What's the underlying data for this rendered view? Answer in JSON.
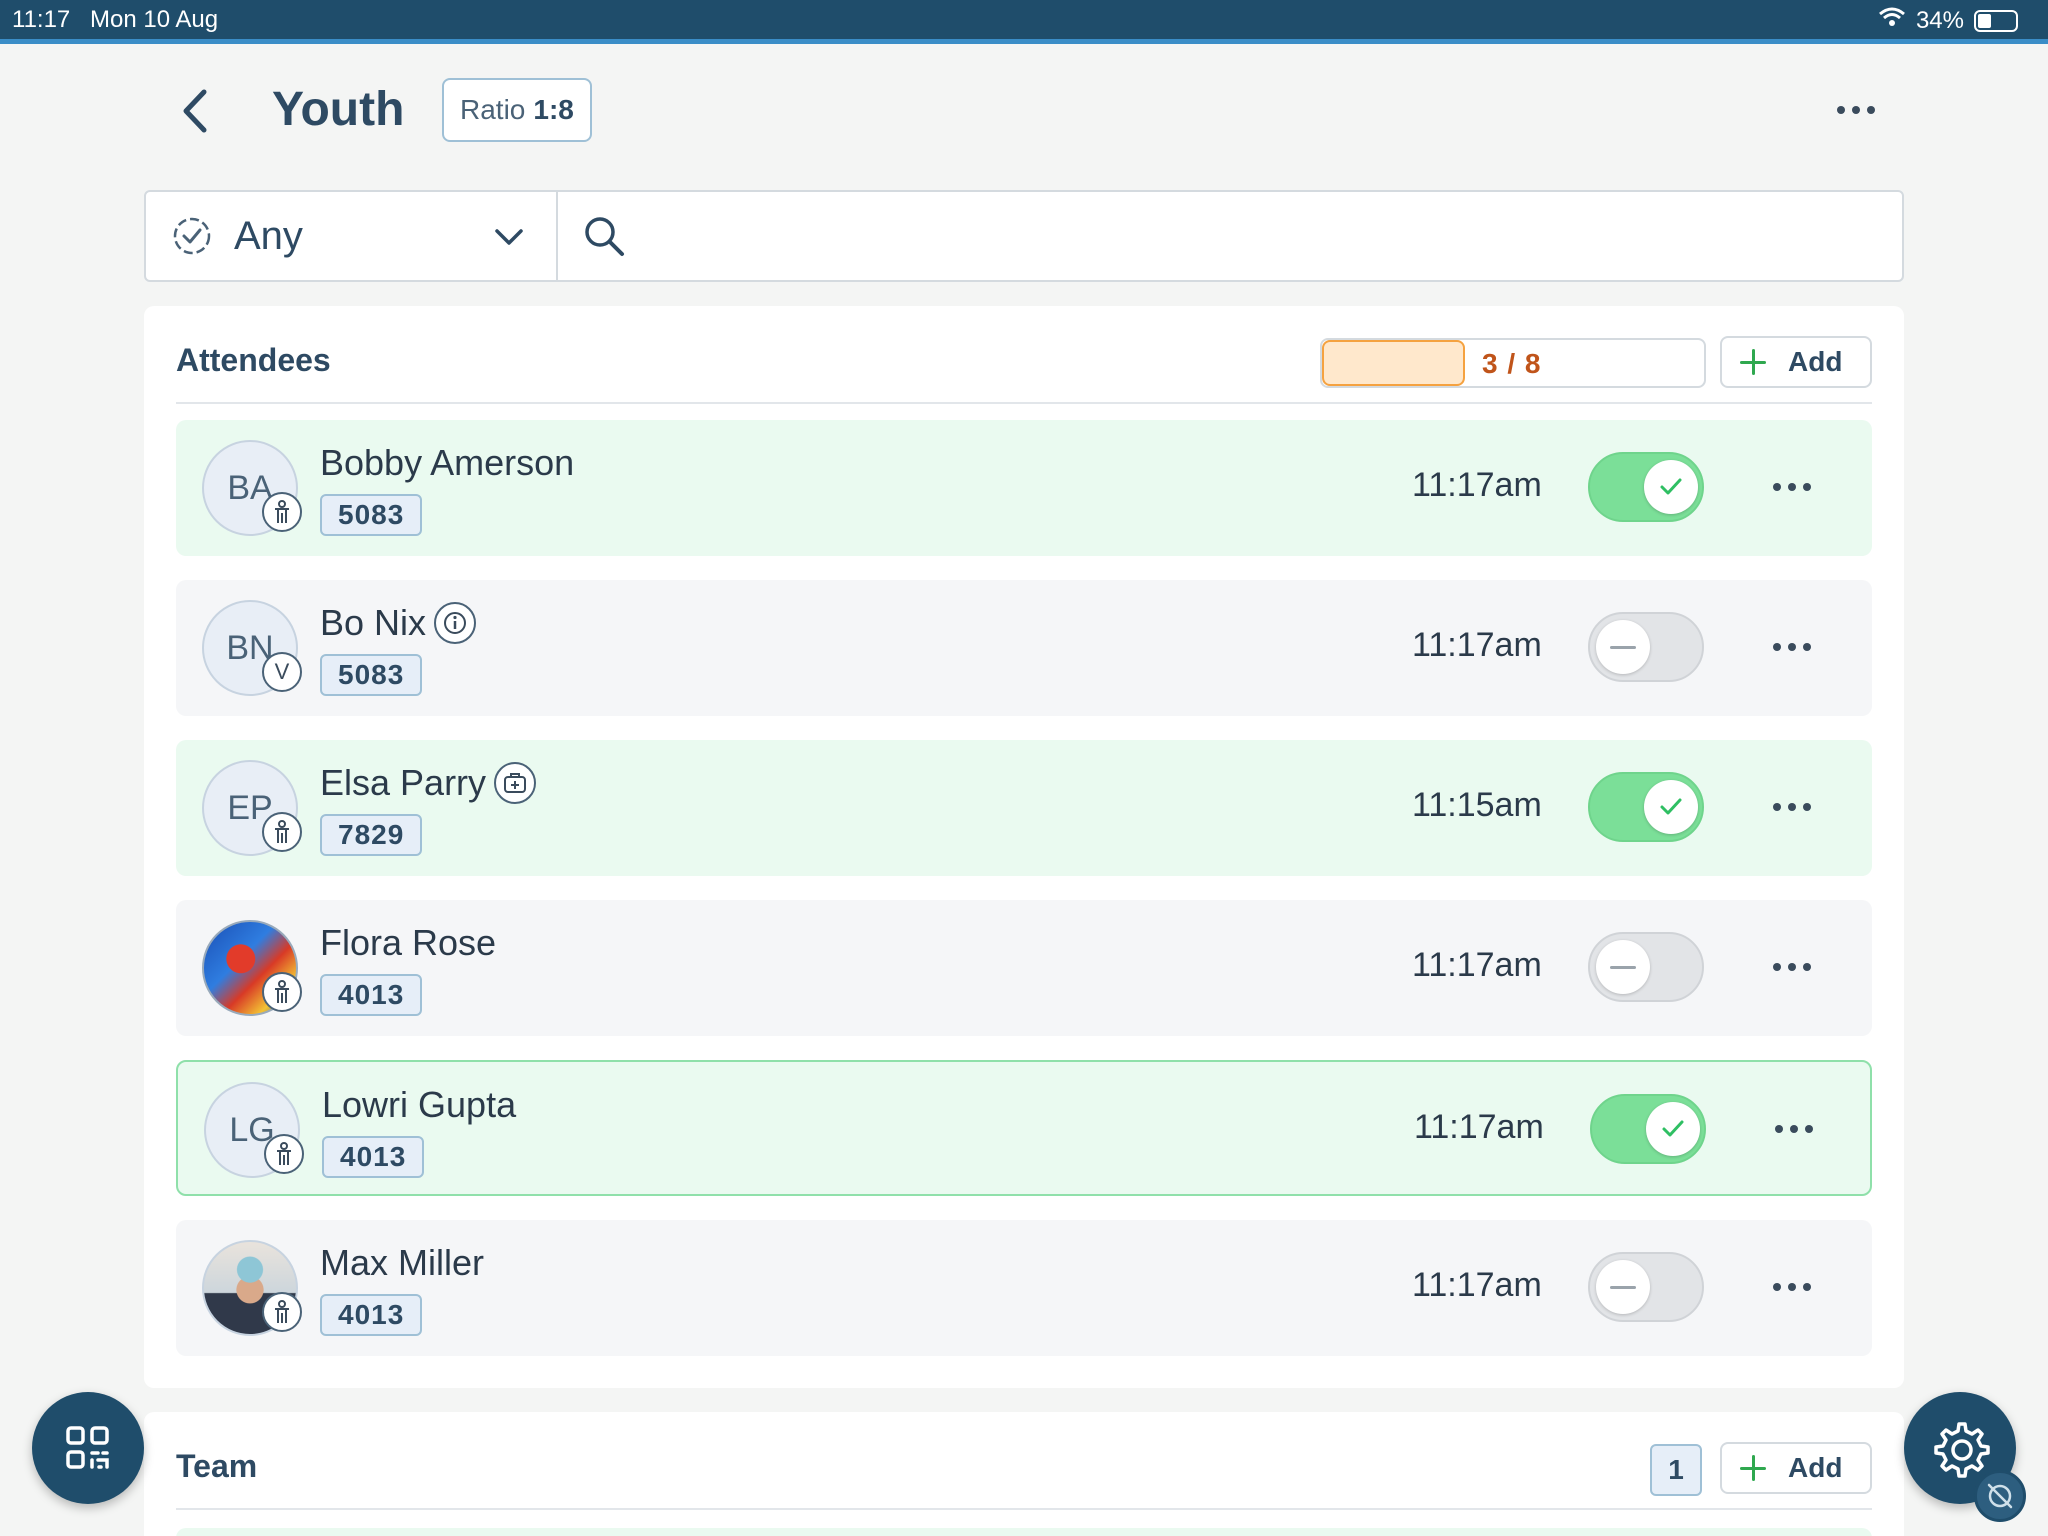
{
  "status_bar": {
    "time": "11:17",
    "date": "Mon 10 Aug",
    "battery": "34%",
    "battery_level": 0.34
  },
  "header": {
    "title": "Youth",
    "ratio_label": "Ratio",
    "ratio_value": "1:8"
  },
  "filter": {
    "selected": "Any",
    "search_placeholder": ""
  },
  "attendees": {
    "title": "Attendees",
    "count_text": "3 / 8",
    "progress_fraction": 0.375,
    "add_label": "Add",
    "rows": [
      {
        "initials": "BA",
        "name": "Bobby Amerson",
        "id": "5083",
        "time": "11:17am",
        "checked_in": true,
        "badge_icon": "person-icon",
        "name_icon": null,
        "avatar": "initials"
      },
      {
        "initials": "BN",
        "name": "Bo Nix",
        "id": "5083",
        "time": "11:17am",
        "checked_in": false,
        "badge_icon": "volunteer-v-icon",
        "badge_text": "V",
        "name_icon": "info-icon",
        "avatar": "initials"
      },
      {
        "initials": "EP",
        "name": "Elsa Parry",
        "id": "7829",
        "time": "11:15am",
        "checked_in": true,
        "badge_icon": "person-icon",
        "name_icon": "medical-kit-icon",
        "avatar": "initials"
      },
      {
        "initials": "",
        "name": "Flora Rose",
        "id": "4013",
        "time": "11:17am",
        "checked_in": false,
        "badge_icon": "person-icon",
        "name_icon": null,
        "avatar": "photo"
      },
      {
        "initials": "LG",
        "name": "Lowri Gupta",
        "id": "4013",
        "time": "11:17am",
        "checked_in": true,
        "badge_icon": "person-icon",
        "name_icon": null,
        "avatar": "initials",
        "selected": true
      },
      {
        "initials": "",
        "name": "Max Miller",
        "id": "4013",
        "time": "11:17am",
        "checked_in": false,
        "badge_icon": "person-icon",
        "name_icon": null,
        "avatar": "photo"
      }
    ]
  },
  "team": {
    "title": "Team",
    "count": "1",
    "add_label": "Add"
  },
  "colors": {
    "primary": "#1f4d6b",
    "checked_bg": "#eafaf0",
    "toggle_on": "#7bdf98",
    "progress_fill": "#ffe8cc",
    "progress_text": "#c0541a",
    "add_plus": "#2fa84f"
  }
}
